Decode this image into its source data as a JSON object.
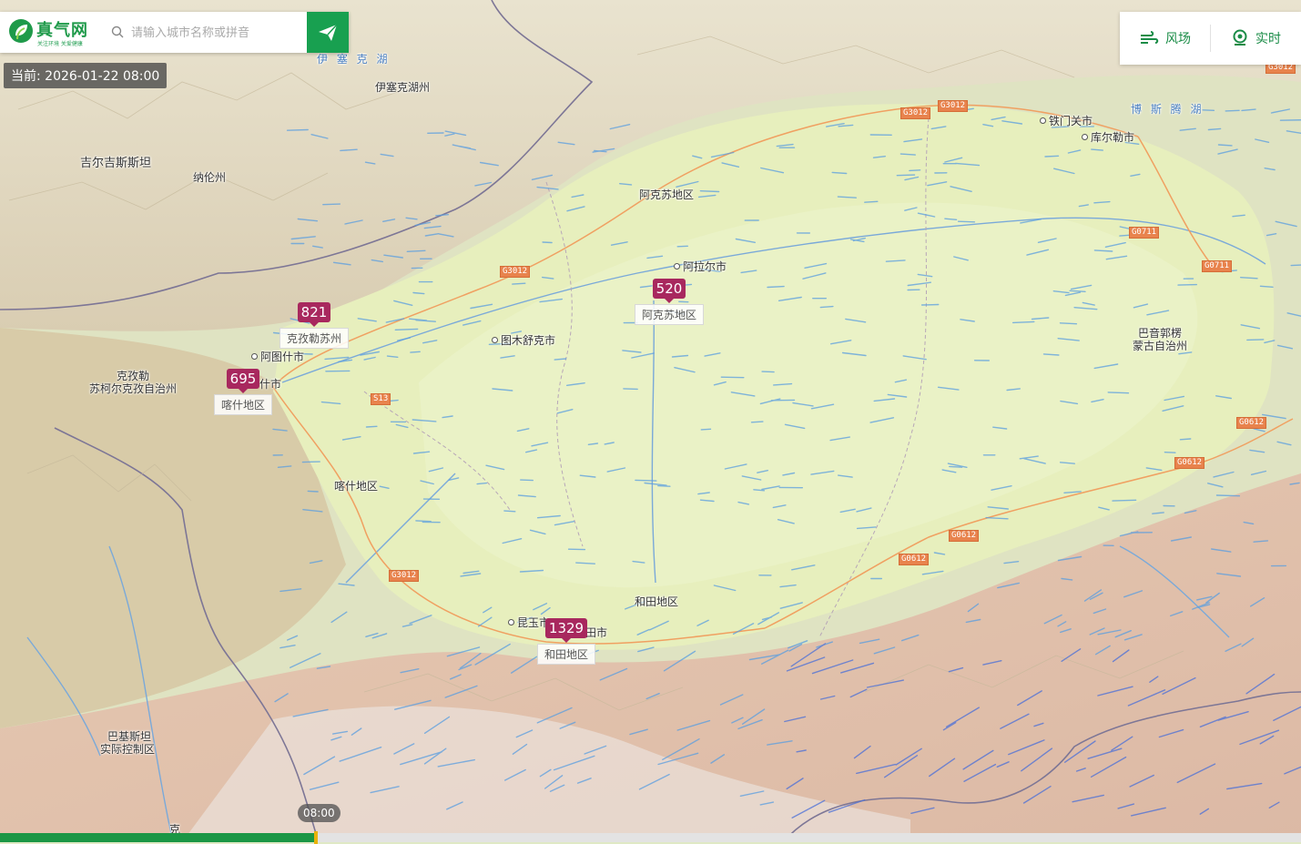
{
  "brand": {
    "name": "真气网",
    "slogan": "关注环境 关爱健康",
    "color": "#1f9a4a"
  },
  "search": {
    "placeholder": "请输入城市名称或拼音",
    "value": ""
  },
  "toolbar": {
    "wind_label": "风场",
    "realtime_label": "实时"
  },
  "current_time": {
    "label": "当前: 2026-01-22 08:00"
  },
  "timeline": {
    "tip": "08:00",
    "progress": 0.243
  },
  "colors": {
    "marker": "#a8285e",
    "accent": "#18a050"
  },
  "markers": [
    {
      "value": "821",
      "label": "克孜勒苏州"
    },
    {
      "value": "695",
      "label": "喀什地区"
    },
    {
      "value": "520",
      "label": "阿克苏地区"
    },
    {
      "value": "1329",
      "label": "和田地区"
    }
  ],
  "places": {
    "yisaike_lake": "伊 塞 克 湖",
    "yisaike_state": "伊塞克湖州",
    "kyrgyzstan": "吉尔吉斯斯坦",
    "naryn": "纳伦州",
    "aksu_region": "阿克苏地区",
    "alar": "阿拉尔市",
    "tumxuk": "图木舒克市",
    "artux": "阿图什市",
    "kashi_city": "什市",
    "kizilsu_1": "克孜勒",
    "kizilsu_2": "苏柯尔克孜自治州",
    "kashi_region": "喀什地区",
    "hotan_region": "和田地区",
    "kunyu": "昆玉市",
    "hotan_city": "田市",
    "tiemenguan": "铁门关市",
    "korla": "库尔勒市",
    "bosten": "博 斯 腾 湖",
    "bayingol_1": "巴音郭楞",
    "bayingol_2": "蒙古自治州",
    "pak_1": "巴基斯坦",
    "pak_2": "实际控制区",
    "bottom_ke": "克"
  },
  "roads": [
    "G3012",
    "G3012",
    "G3012",
    "S13",
    "G3012",
    "G0711",
    "G0711",
    "G0612",
    "G0612",
    "G0612",
    "G0612",
    "G3012"
  ]
}
